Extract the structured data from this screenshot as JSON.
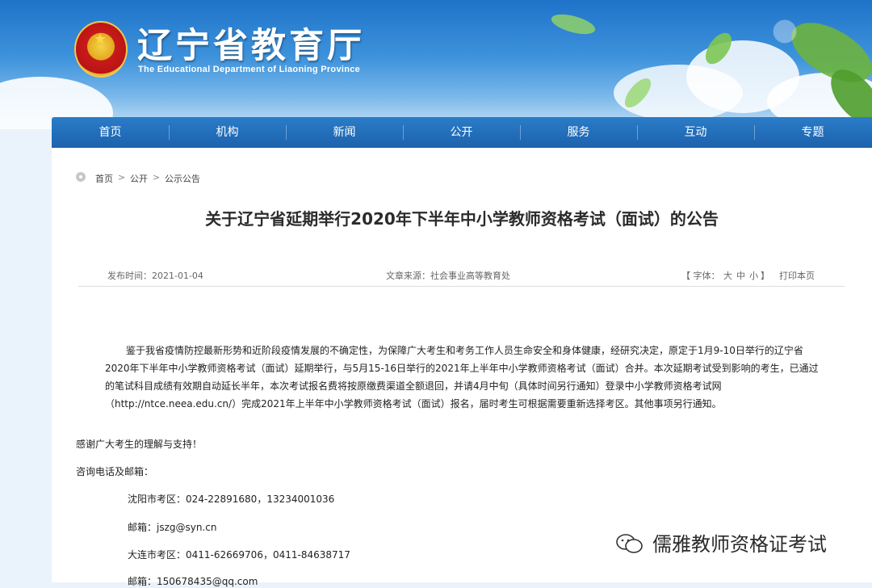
{
  "site": {
    "title": "辽宁省教育厅",
    "subtitle": "The Educational Department of Liaoning Province"
  },
  "nav": {
    "items": [
      {
        "label": "首页"
      },
      {
        "label": "机构"
      },
      {
        "label": "新闻"
      },
      {
        "label": "公开"
      },
      {
        "label": "服务"
      },
      {
        "label": "互动"
      },
      {
        "label": "专题"
      }
    ]
  },
  "breadcrumb": {
    "items": [
      "首页",
      "公开",
      "公示公告"
    ],
    "separator": ">"
  },
  "article": {
    "title": "关于辽宁省延期举行2020年下半年中小学教师资格考试（面试）的公告",
    "publish_time": "发布时间：2021-01-04",
    "source": "文章来源：社会事业高等教育处",
    "font_label": "【 字体：",
    "font_large": "大",
    "font_medium": "中",
    "font_small": "小",
    "font_close": "】",
    "print": "打印本页",
    "paragraph1": "鉴于我省疫情防控最新形势和近阶段疫情发展的不确定性，为保障广大考生和考务工作人员生命安全和身体健康，经研究决定，原定于1月9-10日举行的辽宁省2020年下半年中小学教师资格考试（面试）延期举行，与5月15-16日举行的2021年上半年中小学教师资格考试（面试）合并。本次延期考试受到影响的考生，已通过的笔试科目成绩有效期自动延长半年，本次考试报名费将按原缴费渠道全额退回，并请4月中旬（具体时间另行通知）登录中小学教师资格考试网（http://ntce.neea.edu.cn/）完成2021年上半年中小学教师资格考试（面试）报名，届时考生可根据需要重新选择考区。其他事项另行通知。",
    "thanks": "感谢广大考生的理解与支持！",
    "contact_heading": "咨询电话及邮箱：",
    "shenyang_phone": "沈阳市考区：024-22891680，13234001036",
    "shenyang_email": "邮箱：jszg@syn.cn",
    "dalian_phone": "大连市考区：0411-62669706，0411-84638717",
    "dalian_email": "邮箱：150678435@qq.com"
  },
  "watermark": {
    "text": "儒雅教师资格证考试"
  },
  "colors": {
    "nav_bg": "#1f67b1",
    "banner_top": "#1f73c9"
  }
}
